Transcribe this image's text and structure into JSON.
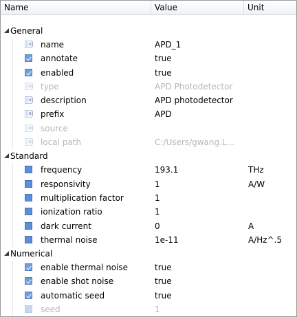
{
  "header": {
    "name": "Name",
    "value": "Value",
    "unit": "Unit"
  },
  "groups": [
    {
      "label": "General",
      "items": [
        {
          "icon": "text",
          "name": "name",
          "value": "APD_1",
          "unit": "",
          "disabled": false
        },
        {
          "icon": "check",
          "name": "annotate",
          "value": "true",
          "unit": "",
          "disabled": false
        },
        {
          "icon": "check",
          "name": "enabled",
          "value": "true",
          "unit": "",
          "disabled": false
        },
        {
          "icon": "text",
          "name": "type",
          "value": "APD Photodetector",
          "unit": "",
          "disabled": true
        },
        {
          "icon": "text",
          "name": "description",
          "value": "APD photodetector",
          "unit": "",
          "disabled": false
        },
        {
          "icon": "text",
          "name": "prefix",
          "value": "APD",
          "unit": "",
          "disabled": false
        },
        {
          "icon": "text",
          "name": "source",
          "value": "",
          "unit": "",
          "disabled": true
        },
        {
          "icon": "text",
          "name": "local path",
          "value": "C:/Users/gwang.L...",
          "unit": "",
          "disabled": true
        }
      ]
    },
    {
      "label": "Standard",
      "items": [
        {
          "icon": "square",
          "name": "frequency",
          "value": "193.1",
          "unit": "THz",
          "disabled": false
        },
        {
          "icon": "square",
          "name": "responsivity",
          "value": "1",
          "unit": "A/W",
          "disabled": false
        },
        {
          "icon": "square",
          "name": "multiplication factor",
          "value": "1",
          "unit": "",
          "disabled": false
        },
        {
          "icon": "square",
          "name": "ionization ratio",
          "value": "1",
          "unit": "",
          "disabled": false
        },
        {
          "icon": "square",
          "name": "dark current",
          "value": "0",
          "unit": "A",
          "disabled": false
        },
        {
          "icon": "square",
          "name": "thermal noise",
          "value": "1e-11",
          "unit": "A/Hz^.5",
          "disabled": false
        }
      ]
    },
    {
      "label": "Numerical",
      "items": [
        {
          "icon": "check",
          "name": "enable thermal noise",
          "value": "true",
          "unit": "",
          "disabled": false
        },
        {
          "icon": "check",
          "name": "enable shot noise",
          "value": "true",
          "unit": "",
          "disabled": false
        },
        {
          "icon": "check",
          "name": "automatic seed",
          "value": "true",
          "unit": "",
          "disabled": false
        },
        {
          "icon": "square",
          "name": "seed",
          "value": "1",
          "unit": "",
          "disabled": true
        }
      ]
    }
  ]
}
